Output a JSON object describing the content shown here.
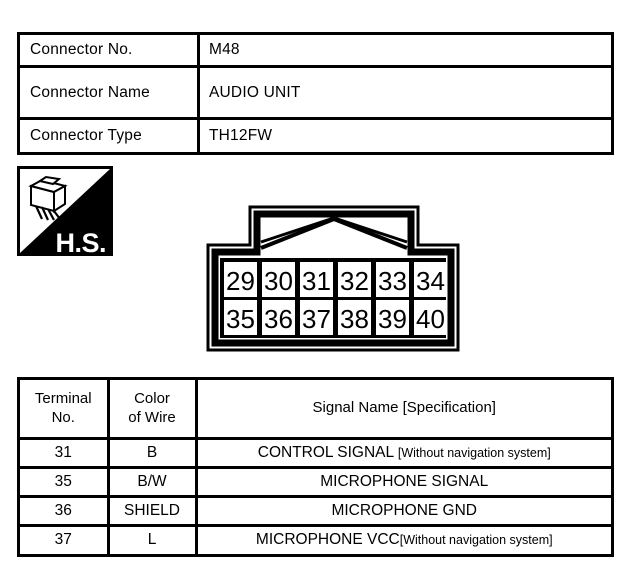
{
  "info": {
    "rows": [
      {
        "label": "Connector No.",
        "value": "M48"
      },
      {
        "label": "Connector Name",
        "value": "AUDIO UNIT"
      },
      {
        "label": "Connector Type",
        "value": "TH12FW"
      }
    ]
  },
  "hs_icon": {
    "label": "H.S.",
    "icon_name": "connector-harness-icon",
    "colors": {
      "fill": "#000000",
      "text": "#ffffff"
    }
  },
  "connector": {
    "name": "audio-unit-connector-pinout",
    "top_row": [
      "29",
      "30",
      "31",
      "32",
      "33",
      "34"
    ],
    "bottom_row": [
      "35",
      "36",
      "37",
      "38",
      "39",
      "40"
    ],
    "colors": {
      "outline": "#000000",
      "cell_fill": "#ffffff"
    }
  },
  "terminal_table": {
    "headers": {
      "terminal_no": [
        "Terminal",
        "No."
      ],
      "color_of_wire": [
        "Color",
        "of Wire"
      ],
      "signal_name": "Signal Name [Specification]"
    },
    "rows": [
      {
        "terminal_no": "31",
        "color_of_wire": "B",
        "signal_main": "CONTROL SIGNAL ",
        "signal_spec": "[Without navigation system]",
        "signal_full": "CONTROL SIGNAL [Without navigation system]"
      },
      {
        "terminal_no": "35",
        "color_of_wire": "B/W",
        "signal_main": "MICROPHONE SIGNAL",
        "signal_spec": "",
        "signal_full": "MICROPHONE SIGNAL"
      },
      {
        "terminal_no": "36",
        "color_of_wire": "SHIELD",
        "signal_main": "MICROPHONE GND",
        "signal_spec": "",
        "signal_full": "MICROPHONE GND"
      },
      {
        "terminal_no": "37",
        "color_of_wire": "L",
        "signal_main": "MICROPHONE VCC",
        "signal_spec": "[Without navigation system]",
        "signal_full": "MICROPHONE VCC[Without navigation system]"
      }
    ]
  }
}
